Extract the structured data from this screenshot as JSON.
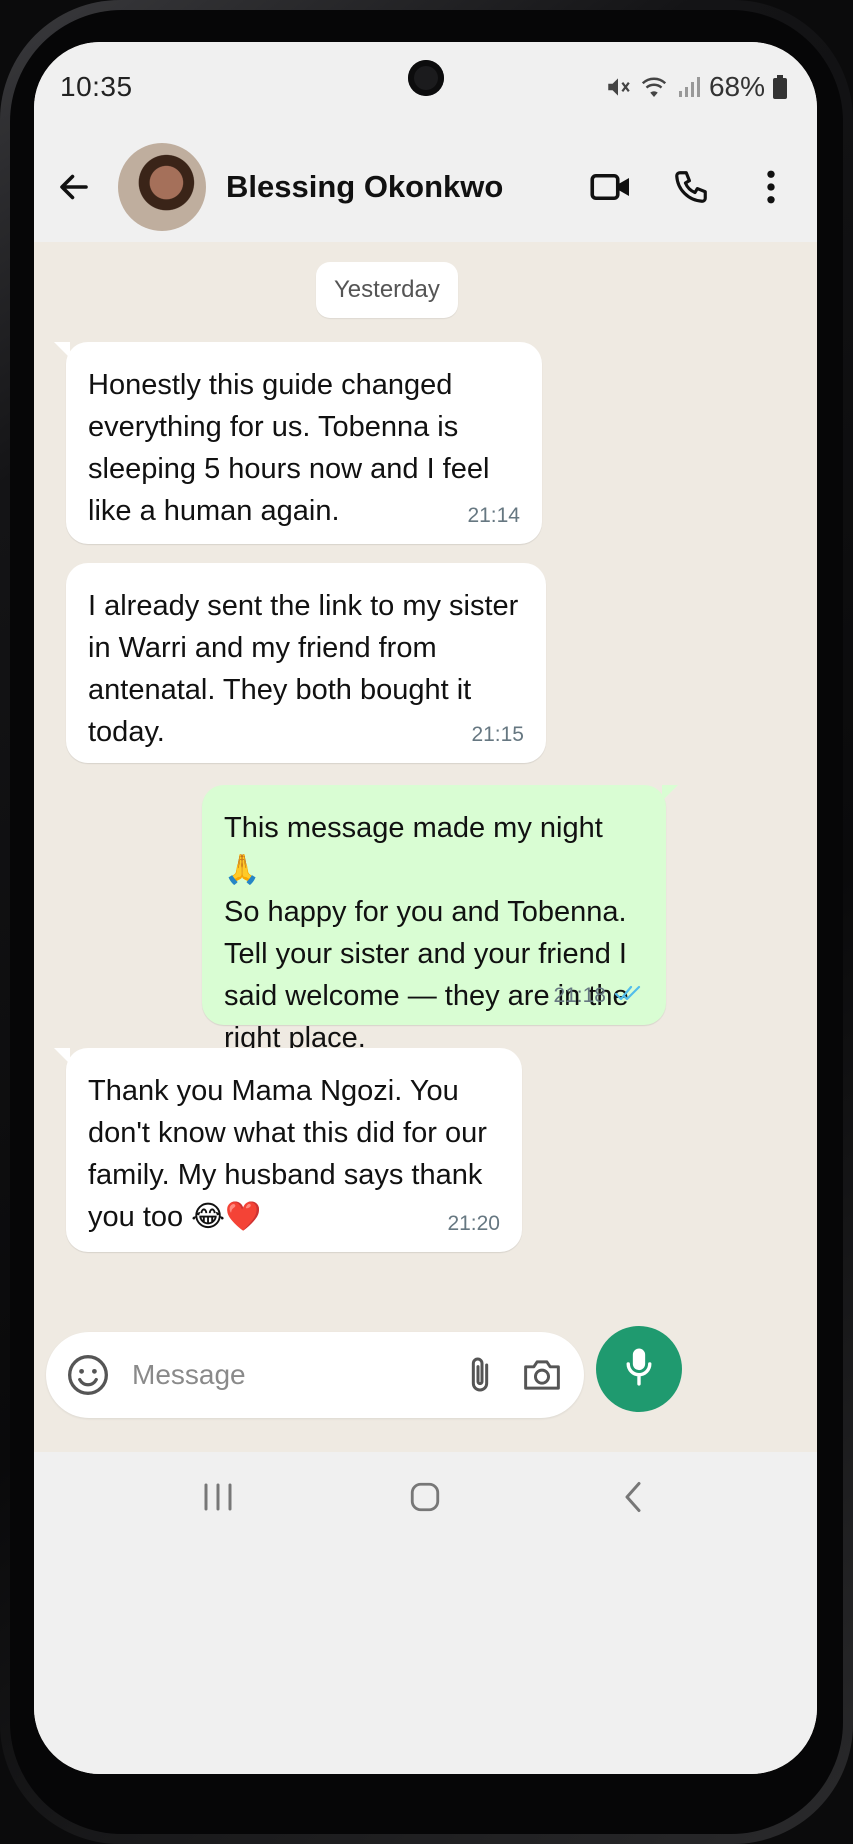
{
  "status_bar": {
    "time": "10:35",
    "battery": "68%",
    "icons": [
      "mute-icon",
      "wifi-icon",
      "signal-icon",
      "battery-icon"
    ]
  },
  "header": {
    "contact_name": "Blessing Okonkwo",
    "icons": [
      "back-arrow-icon",
      "video-call-icon",
      "phone-call-icon",
      "more-vert-icon"
    ]
  },
  "chat": {
    "date_label": "Yesterday",
    "messages": [
      {
        "direction": "incoming",
        "text": "Honestly this guide changed\neverything for us. Tobenna is\nsleeping 5 hours now and I feel\nlike a human again.",
        "time": "21:14"
      },
      {
        "direction": "incoming",
        "text": "I already sent the link to my sister\nin Warri and my friend from\nantenatal. They both bought it\ntoday.",
        "time": "21:15"
      },
      {
        "direction": "outgoing",
        "text": "This message made my night 🙏\nSo happy for you and Tobenna.\nTell your sister and your friend I\nsaid welcome — they are in the\nright place.",
        "time": "21:18",
        "status": "read"
      },
      {
        "direction": "incoming",
        "text": "Thank you Mama Ngozi. You\ndon't know what this did for our\nfamily. My husband says thank\nyou too 😂❤️",
        "time": "21:20"
      }
    ]
  },
  "composer": {
    "placeholder": "Message",
    "icons": [
      "emoji-icon",
      "attach-icon",
      "camera-icon",
      "mic-icon"
    ]
  },
  "colors": {
    "chat_bg": "#efeae2",
    "incoming_bubble": "#ffffff",
    "outgoing_bubble": "#d9fdd3",
    "accent": "#1f9a6f",
    "read_tick": "#53bdeb"
  }
}
